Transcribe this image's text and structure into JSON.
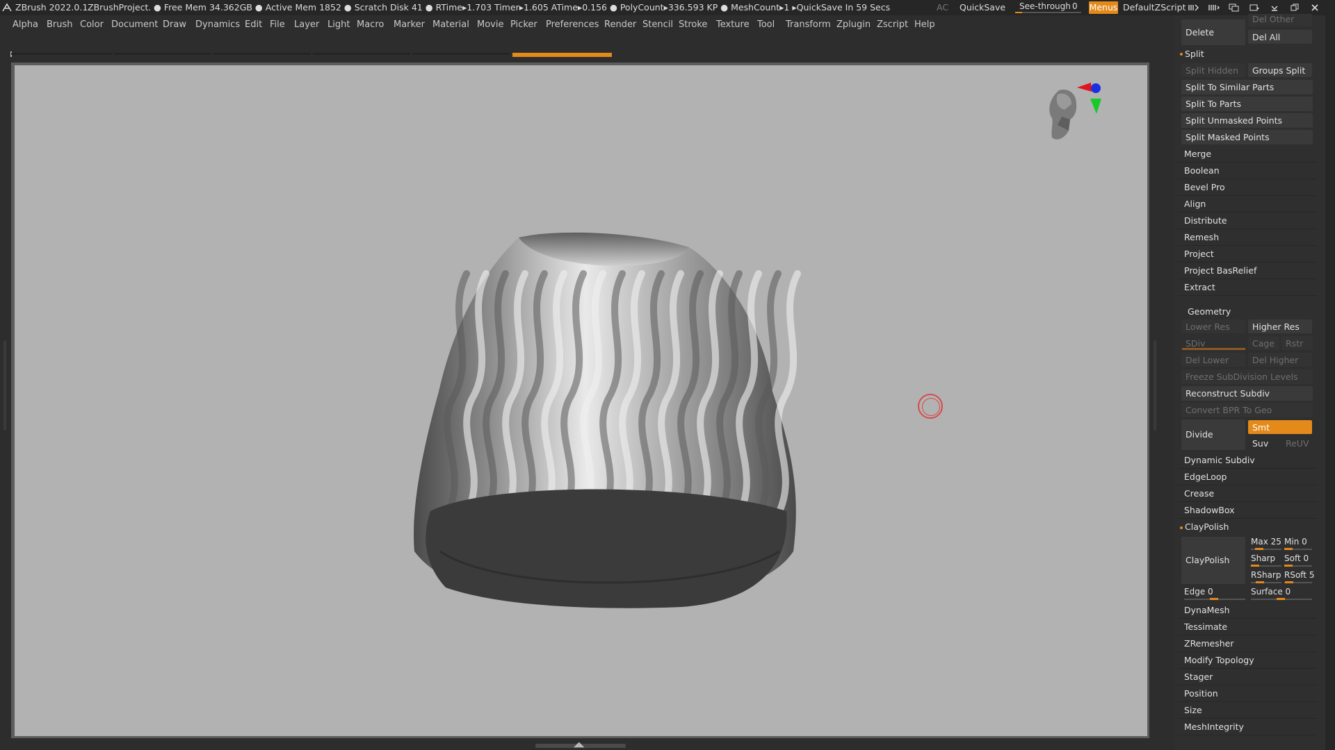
{
  "titlebar": {
    "app_name": "ZBrush 2022.0.1",
    "project": "ZBrushProject",
    "stats": ". ● Free Mem 34.362GB ● Active Mem 1852 ● Scratch Disk 41 ●   RTime▸1.703 Timer▸1.605 ATime▸0.156 ● PolyCount▸336.593 KP  ● MeshCount▸1  ▸QuickSave In 59 Secs",
    "ac": "AC",
    "quicksave": "QuickSave",
    "see_through_label": "See-through",
    "see_through_value": "0",
    "see_through_fraction": 0.0,
    "menus": "Menus",
    "script": "DefaultZScript",
    "window_icons": [
      "palette-icon",
      "brush-icon",
      "layout-icon",
      "settings-icon",
      "minimize-icon",
      "restore-icon",
      "close-icon"
    ]
  },
  "menubar": {
    "items": [
      "Alpha",
      "Brush",
      "Color",
      "Document",
      "Draw",
      "Dynamics",
      "Edit",
      "File",
      "Layer",
      "Light",
      "Macro",
      "Marker",
      "Material",
      "Movie",
      "Picker",
      "Preferences",
      "Render",
      "Stencil",
      "Stroke",
      "Texture",
      "Tool",
      "Transform",
      "Zplugin",
      "Zscript",
      "Help"
    ]
  },
  "viewport": {
    "background": "#b2b2b2",
    "object": "twisted-ribbed-vase-mesh",
    "navigator": "head-navigator-gizmo"
  },
  "panel": {
    "delete": "Delete",
    "del_other": "Del Other",
    "del_all": "Del All",
    "split": {
      "title": "Split",
      "split_hidden": "Split Hidden",
      "groups_split": "Groups Split",
      "items": [
        "Split To Similar Parts",
        "Split To Parts",
        "Split Unmasked Points",
        "Split Masked Points"
      ]
    },
    "subtool_items": [
      "Merge",
      "Boolean",
      "Bevel Pro",
      "Align",
      "Distribute",
      "Remesh",
      "Project",
      "Project BasRelief",
      "Extract"
    ],
    "geometry": {
      "title": "Geometry",
      "lower_res": "Lower Res",
      "higher_res": "Higher Res",
      "sdiv": "SDiv",
      "cage": "Cage",
      "rstr": "Rstr",
      "del_lower": "Del Lower",
      "del_higher": "Del Higher",
      "freeze": "Freeze SubDivision Levels",
      "reconstruct": "Reconstruct Subdiv",
      "convert_bpr": "Convert BPR To Geo",
      "divide": "Divide",
      "smt": "Smt",
      "suv": "Suv",
      "reuv": "ReUV",
      "items": [
        "Dynamic Subdiv",
        "EdgeLoop",
        "Crease",
        "ShadowBox"
      ]
    },
    "claypolish": {
      "title": "ClayPolish",
      "button": "ClayPolish",
      "max_label": "Max",
      "max_value": "25",
      "min_label": "Min",
      "min_value": "0",
      "sharp_label": "Sharp",
      "sharp_value": "",
      "soft_label": "Soft",
      "soft_value": "0",
      "rsharp_label": "RSharp",
      "rsharp_value": "",
      "rsoft_label": "RSoft",
      "rsoft_value": "5",
      "edge_label": "Edge",
      "edge_value": "0",
      "surface_label": "Surface",
      "surface_value": "0"
    },
    "geometry_items2": [
      "DynaMesh",
      "Tessimate",
      "ZRemesher",
      "Modify Topology",
      "Stager",
      "Position",
      "Size",
      "MeshIntegrity"
    ],
    "accent_color": "#e38a1b"
  }
}
